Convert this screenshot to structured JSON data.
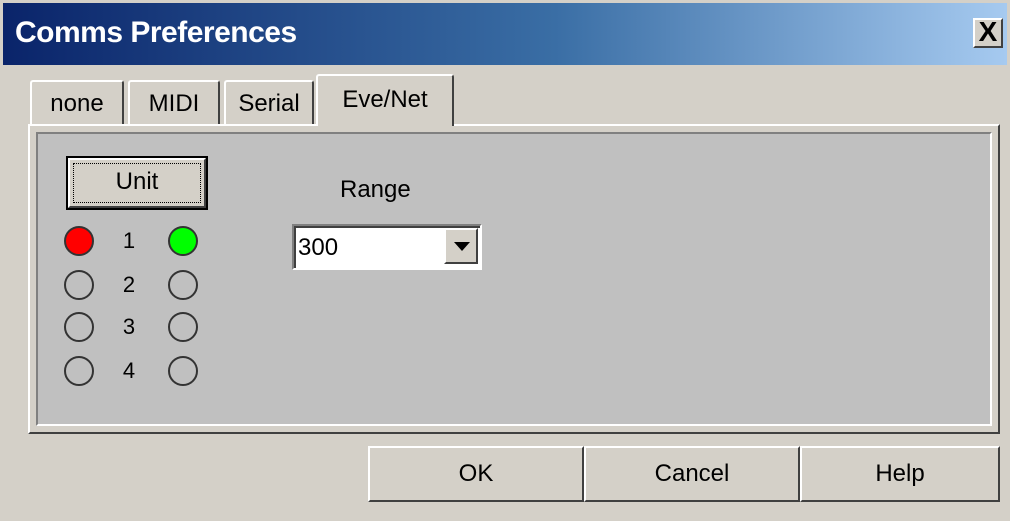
{
  "window": {
    "title": "Comms Preferences",
    "close_label": "X"
  },
  "tabs": [
    {
      "label": "none",
      "active": false
    },
    {
      "label": "MIDI",
      "active": false
    },
    {
      "label": "Serial",
      "active": false
    },
    {
      "label": "Eve/Net",
      "active": true
    }
  ],
  "panel": {
    "unit_button": "Unit",
    "units": [
      {
        "number": "1",
        "left_led": "red",
        "right_led": "green"
      },
      {
        "number": "2",
        "left_led": "off",
        "right_led": "off"
      },
      {
        "number": "3",
        "left_led": "off",
        "right_led": "off"
      },
      {
        "number": "4",
        "left_led": "off",
        "right_led": "off"
      }
    ],
    "range_label": "Range",
    "range_value": "300"
  },
  "buttons": {
    "ok": "OK",
    "cancel": "Cancel",
    "help": "Help"
  },
  "colors": {
    "led_red": "#ff0000",
    "led_green": "#00ff00",
    "title_gradient_start": "#0a246a",
    "title_gradient_end": "#a6caf0"
  }
}
